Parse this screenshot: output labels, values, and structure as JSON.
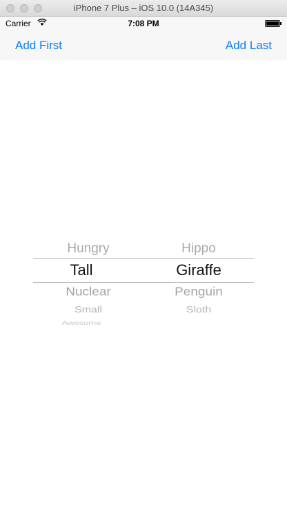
{
  "window": {
    "title": "iPhone 7 Plus – iOS 10.0 (14A345)"
  },
  "status_bar": {
    "carrier": "Carrier",
    "time": "7:08 PM",
    "icons": [
      "wifi-icon",
      "battery-icon"
    ]
  },
  "nav": {
    "left_label": "Add First",
    "right_label": "Add Last",
    "tint": "#0a7aff"
  },
  "picker": {
    "column1": {
      "prev": "Hungry",
      "selected": "Tall",
      "next": [
        "Nuclear",
        "Small",
        "Awesome"
      ]
    },
    "column2": {
      "prev": "Hippo",
      "selected": "Giraffe",
      "next": [
        "Penguin",
        "Sloth"
      ]
    }
  }
}
